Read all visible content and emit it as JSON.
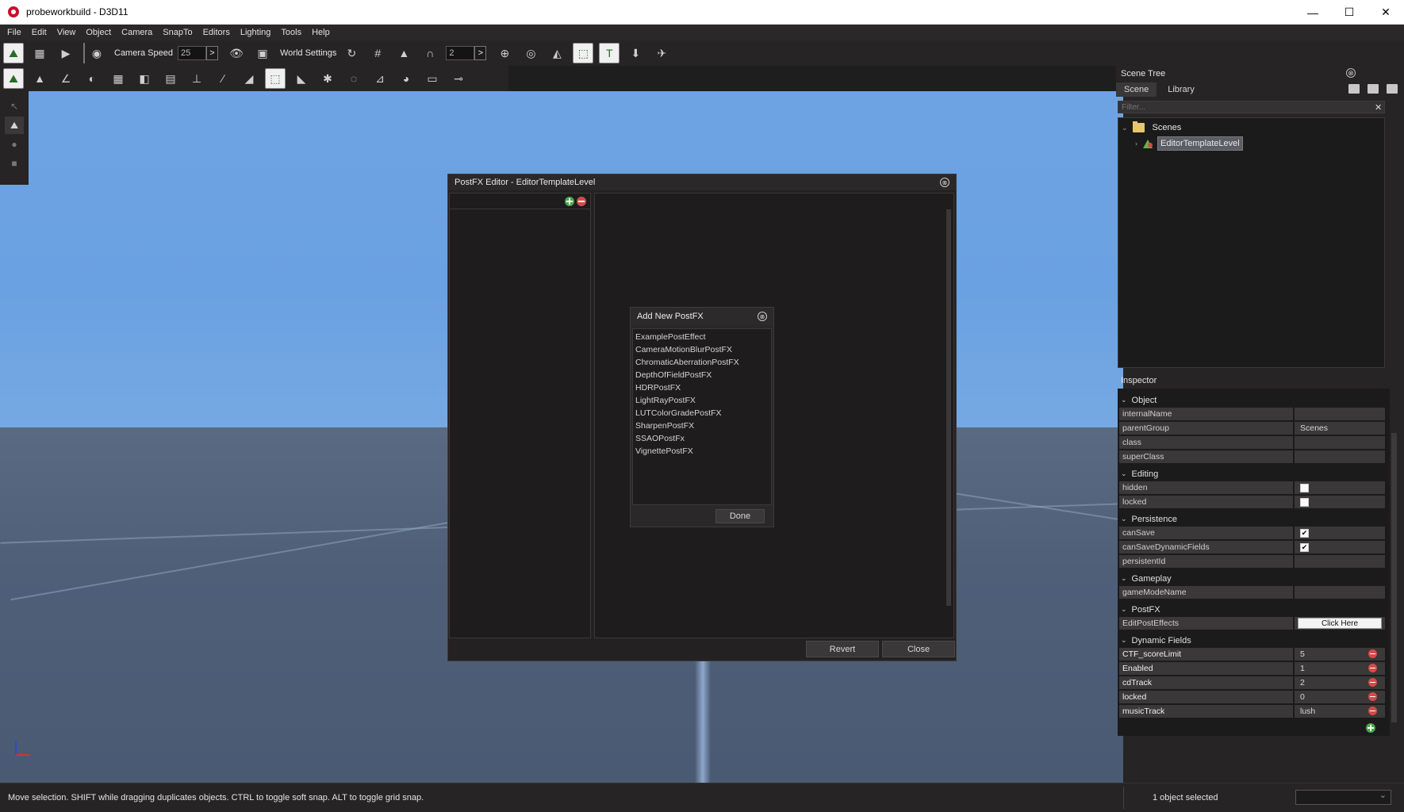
{
  "window": {
    "title": "probeworkbuild - D3D11",
    "min": "—",
    "max": "☐",
    "close": "✕"
  },
  "menu": [
    "File",
    "Edit",
    "View",
    "Object",
    "Camera",
    "SnapTo",
    "Editors",
    "Lighting",
    "Tools",
    "Help"
  ],
  "toolbar": {
    "camera_speed_label": "Camera Speed",
    "camera_speed_value": "25",
    "world_settings_label": "World Settings",
    "grid_value": "2",
    "arrow": ">"
  },
  "scene_tree": {
    "title": "Scene Tree",
    "tabs": [
      "Scene",
      "Library"
    ],
    "filter_placeholder": "Filter...",
    "filter_clear": "✕",
    "root": "Scenes",
    "child": "EditorTemplateLevel"
  },
  "inspector": {
    "title": "Inspector",
    "groups": {
      "object": "Object",
      "editing": "Editing",
      "persistence": "Persistence",
      "gameplay": "Gameplay",
      "postfx": "PostFX",
      "dynamic": "Dynamic Fields"
    },
    "props": {
      "internalName": {
        "name": "internalName",
        "value": ""
      },
      "parentGroup": {
        "name": "parentGroup",
        "value": "Scenes"
      },
      "class": {
        "name": "class",
        "value": ""
      },
      "superClass": {
        "name": "superClass",
        "value": ""
      },
      "hidden": {
        "name": "hidden",
        "checked": ""
      },
      "locked": {
        "name": "locked",
        "checked": ""
      },
      "canSave": {
        "name": "canSave",
        "checked": "✔"
      },
      "canSaveDynamicFields": {
        "name": "canSaveDynamicFields",
        "checked": "✔"
      },
      "persistentId": {
        "name": "persistentId",
        "value": ""
      },
      "gameModeName": {
        "name": "gameModeName",
        "value": ""
      },
      "editPostEffects": {
        "name": "EditPostEffects",
        "button": "Click Here"
      }
    },
    "dynamic_fields": [
      {
        "name": "CTF_scoreLimit",
        "value": "5"
      },
      {
        "name": "Enabled",
        "value": "1"
      },
      {
        "name": "cdTrack",
        "value": "2"
      },
      {
        "name": "locked",
        "value": "0"
      },
      {
        "name": "musicTrack",
        "value": "lush"
      }
    ]
  },
  "postfx_editor": {
    "title": "PostFX Editor - EditorTemplateLevel",
    "revert": "Revert",
    "close": "Close",
    "close_icon": "⊗"
  },
  "add_postfx": {
    "title": "Add New PostFX",
    "items": [
      "ExamplePostEffect",
      "CameraMotionBlurPostFX",
      "ChromaticAberrationPostFX",
      "DepthOfFieldPostFX",
      "HDRPostFX",
      "LightRayPostFX",
      "LUTColorGradePostFX",
      "SharpenPostFX",
      "SSAOPostFx",
      "VignettePostFX"
    ],
    "done": "Done"
  },
  "status": {
    "message": "Move selection.  SHIFT while dragging duplicates objects.  CTRL to toggle soft snap.  ALT to toggle grid snap.",
    "selection": "1 object selected"
  }
}
